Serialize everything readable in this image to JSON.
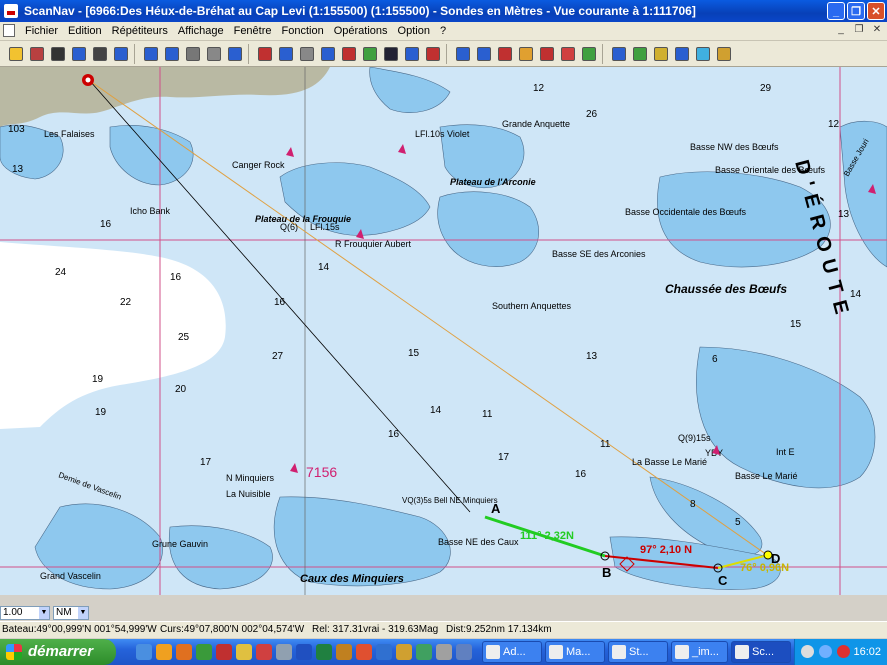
{
  "window": {
    "title": "ScanNav - [6966:Des Héux-de-Bréhat au Cap Levi (1:155500) (1:155500) - Sondes en  Mètres  - Vue courante à 1:111706]",
    "buttons": [
      "minimize",
      "restore",
      "close"
    ]
  },
  "menu": [
    "Fichier",
    "Edition",
    "Répétiteurs",
    "Affichage",
    "Fenêtre",
    "Fonction",
    "Opérations",
    "Option",
    "?"
  ],
  "toolbar": {
    "icons": [
      "open-chart-icon",
      "print-preview-icon",
      "save-icon",
      "help-pointer-icon",
      "print-icon",
      "whats-this-icon",
      "zoom-in-icon",
      "zoom-out-icon",
      "pan-hand-icon",
      "select-rect-icon",
      "rotate-icon",
      "anchor-icon",
      "crosshair-icon",
      "route-icon",
      "draw-line-icon",
      "erase-icon",
      "bearing-icon",
      "text-icon",
      "color-text-icon",
      "gps-icon",
      "heading-icon",
      "north-up-icon",
      "target-icon",
      "route-plan-icon",
      "man-overboard-icon",
      "lifebuoy-icon",
      "tide-icon",
      "layers-icon",
      "grid-icon",
      "waypoints-icon",
      "track-icon",
      "wind-icon",
      "about-icon"
    ]
  },
  "chart": {
    "labels": [
      "Les Falaises",
      "Canger Rock",
      "Icho Bank",
      "Plateau de la Frouquie",
      "R Frouquier Aubert",
      "LFl.15s",
      "Q(6)",
      "Plateau de l'Arconie",
      "Grande Anquette",
      "LFl.10s Violet",
      "Basse NW des Bœufs",
      "Basse Orientale des Bœufs",
      "Basse Occidentale des Bœufs",
      "Basse SE des Arconies",
      "Chaussée des Bœufs",
      "Southern Anquettes",
      "D'ÉROUTE",
      "Basse Jouri",
      "N Minquiers",
      "La Nuisible",
      "VQ(3)5s Bell NE Minquiers",
      "Basse NE des Caux",
      "Demie de Vascelin",
      "Grand Vascelin",
      "Caux des Minquiers",
      "Grune Gauvin",
      "La Basse Le Marié",
      "Basse Le Marié",
      "Q(9)15s",
      "YBY",
      "Int E"
    ],
    "soundings": [
      "103",
      "13",
      "16",
      "24",
      "22",
      "25",
      "27",
      "19",
      "20",
      "16",
      "14",
      "16",
      "15",
      "14",
      "11",
      "19",
      "16",
      "13",
      "29",
      "12",
      "26",
      "17",
      "6",
      "11",
      "8",
      "5",
      "12",
      "13",
      "14",
      "15",
      "16",
      "17"
    ],
    "chart_number": "7156",
    "route": {
      "legs": [
        {
          "label": "111° 2,32N",
          "color": "#22cc22"
        },
        {
          "label": "97° 2,10 N",
          "color": "#cc0000"
        },
        {
          "label": "76° 0,96N",
          "color": "#dddd00"
        }
      ],
      "waypoints": [
        "A",
        "B",
        "C",
        "D"
      ]
    }
  },
  "scale_combo": {
    "value": "1.00"
  },
  "unit_combo": {
    "value": "NM"
  },
  "status": {
    "bateau": "Bateau:49°00,999'N 001°54,999'W",
    "curseur": "Curs:49°07,800'N 002°04,574'W",
    "relevement": "Rel: 317.31vrai - 319.63Mag",
    "distance": "Dist:9.252nm  17.134km"
  },
  "taskbar": {
    "start_label": "démarrer",
    "tasks": [
      "Ad...",
      "Ma...",
      "St...",
      "_im...",
      "Sc..."
    ],
    "clock": "16:02"
  },
  "colors": {
    "sea_deep": "#ffffff",
    "sea_shallow": "#cfe6f7",
    "shoal": "#8ec8ee",
    "land": "#b8b8a0",
    "route_leg1": "#22cc22",
    "route_leg2": "#cc0000",
    "route_leg3": "#dddd00"
  }
}
